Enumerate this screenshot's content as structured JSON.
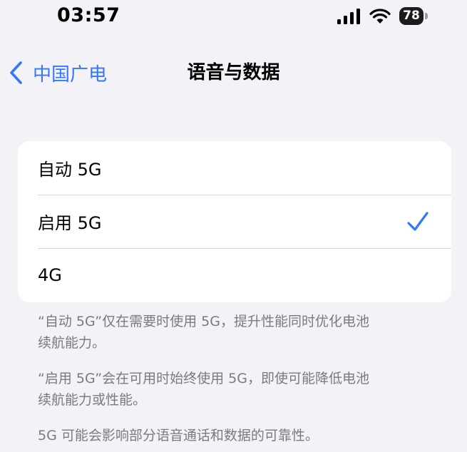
{
  "status_bar": {
    "time": "03:57",
    "signal_icon": "cellular-signal-icon",
    "wifi_icon": "wifi-icon",
    "battery_level": "78"
  },
  "nav": {
    "back_label": "中国广电",
    "back_icon": "chevron-left-icon",
    "title": "语音与数据"
  },
  "options": [
    {
      "label": "自动 5G",
      "selected": false
    },
    {
      "label": "启用 5G",
      "selected": true
    },
    {
      "label": "4G",
      "selected": false
    }
  ],
  "footnotes": [
    {
      "line1": "“自动 5G”仅在需要时使用 5G，提升性能同时优化电池",
      "line2": "续航能力。"
    },
    {
      "line1": "“启用 5G”会在可用时始终使用 5G，即使可能降低电池",
      "line2": "续航能力或性能。"
    },
    {
      "line1": "5G 可能会影响部分语音通话和数据的可靠性。"
    }
  ],
  "colors": {
    "accent": "#3478f6",
    "background": "#f2f2f7",
    "card": "#ffffff",
    "footnote_text": "#7a7a7f"
  }
}
